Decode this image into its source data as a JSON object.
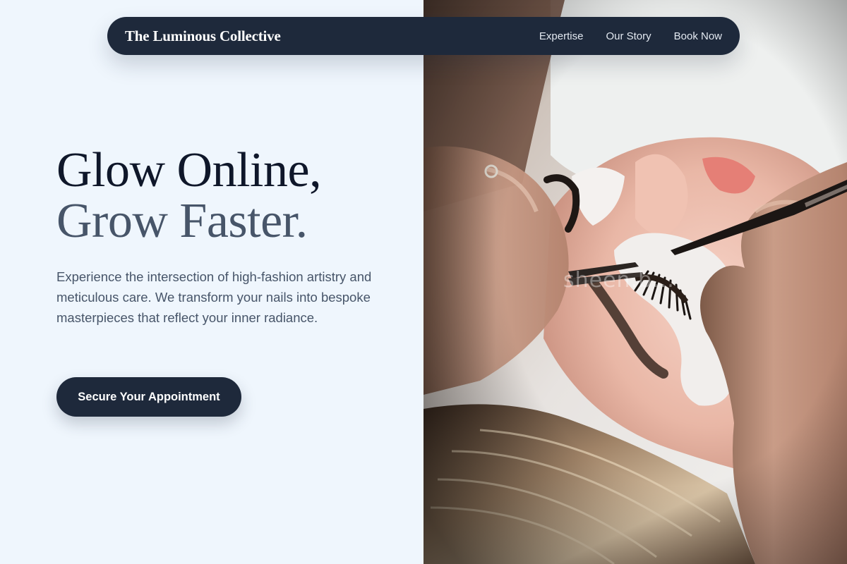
{
  "nav": {
    "brand": "The Luminous Collective",
    "links": [
      {
        "label": "Expertise"
      },
      {
        "label": "Our Story"
      },
      {
        "label": "Book Now"
      }
    ]
  },
  "hero": {
    "headline_line1": "Glow Online,",
    "headline_line2": "Grow Faster.",
    "description": "Experience the intersection of high-fashion artistry and meticulous care. We transform your nails into bespoke masterpieces that reflect your inner radiance.",
    "cta_label": "Secure Your Appointment",
    "image_watermark": "sheen.b..."
  },
  "colors": {
    "background": "#eff6fd",
    "nav_background": "#1e293b",
    "headline_primary": "#0f172a",
    "headline_secondary": "#475569",
    "body_text": "#475569",
    "cta_background": "#1e293b",
    "cta_text": "#ffffff"
  },
  "icons": [
    "tweezers-icon"
  ]
}
